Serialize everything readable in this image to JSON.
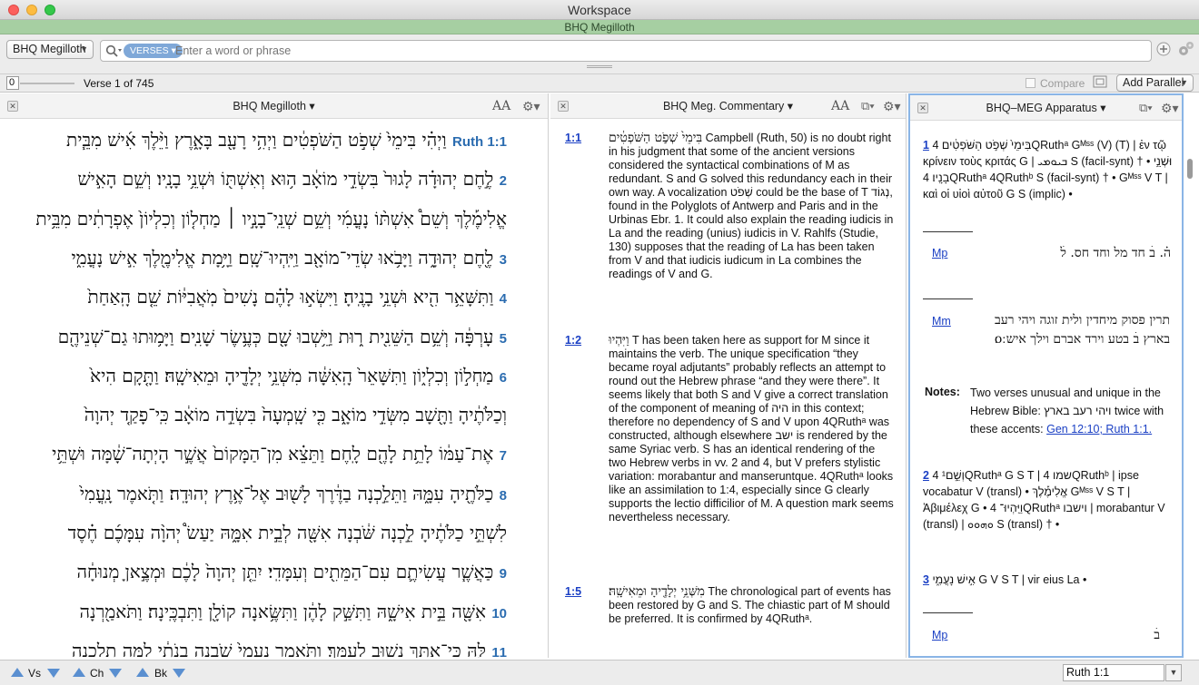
{
  "window": {
    "title": "Workspace",
    "subtitle": "BHQ Megilloth"
  },
  "toolbar": {
    "resource": "BHQ Megilloth",
    "search_scope": "VERSES",
    "search_placeholder": "Enter a word or phrase"
  },
  "navbar": {
    "position_box": "0",
    "verse_info": "Verse 1 of 745",
    "compare": "Compare",
    "add_parallel": "Add Parallel"
  },
  "panes": {
    "text": {
      "title": "BHQ Megilloth",
      "font_btn": "AA"
    },
    "commentary": {
      "title": "BHQ Meg. Commentary",
      "font_btn": "AA"
    },
    "apparatus": {
      "title": "BHQ–MEG Apparatus"
    }
  },
  "text_lines": [
    {
      "vn": "Ruth 1:1",
      "t": "וַיְהִ֗י בִּימֵי֙ שְׁפֹ֣ט הַשֹּׁפְטִ֔ים וַיְהִ֥י רָעָ֖ב בָּאָ֑רֶץ וַיֵּ֨לֶךְ אִ֜ישׁ מִבֵּ֧ית"
    },
    {
      "vn": "2",
      "t": "לֶ֣חֶם יְהוּדָ֗ה לָגוּר֙ בִּשְׂדֵ֣י מוֹאָ֔ב ה֥וּא וְאִשְׁתּ֖וֹ וּשְׁנֵ֥י בָנָֽיו׃ וְשֵׁ֣ם הָאִ֣ישׁ"
    },
    {
      "vn": "",
      "t": "אֱלִימֶ֡לֶךְ וְשֵׁם֩ אִשְׁתּ֨וֹ נָעֳמִ֜י וְשֵׁ֥ם שְׁנֵֽי־בָנָ֣יו ׀ מַחְל֤וֹן וְכִלְיוֹן֙ אֶפְרָתִ֔ים מִבֵּ֥ית"
    },
    {
      "vn": "3",
      "t": "לֶ֖חֶם יְהוּדָ֑ה וַיָּבֹ֥אוּ שְׂדֵי־מוֹאָ֖ב וַיִּֽהְיוּ־שָֽׁם׃ וַיָּ֥מָת אֱלִימֶ֖לֶךְ אִ֣ישׁ נָעֳמִ֑י"
    },
    {
      "vn": "4",
      "t": "וַתִּשָּׁאֵ֥ר הִ֖יא וּשְׁנֵ֥י בָנֶֽיהָ׃ וַיִּשְׂא֣וּ לָהֶ֗ם נָשִׁים֙ מֹֽאֲבִיּ֔וֹת שֵׁ֤ם הָֽאַחַת֙"
    },
    {
      "vn": "5",
      "t": "עָרְפָּ֔ה וְשֵׁ֥ם הַשֵּׁנִ֖ית ר֑וּת וַיֵּ֥שְׁבוּ שָׁ֖ם כְּעֶ֥שֶׂר שָׁנִֽים׃ וַיָּמ֥וּתוּ גַם־שְׁנֵיהֶ֖ם"
    },
    {
      "vn": "6",
      "t": "מַחְל֣וֹן וְכִלְי֑וֹן וַתִּשָּׁאֵר֙ הָֽאִשָּׁ֔ה מִשְּׁנֵ֥י יְלָדֶ֖יהָ וּמֵאִישָֽׁהּ׃ וַתָּ֤קָם הִיא֙"
    },
    {
      "vn": "",
      "t": "וְכַלֹּתֶ֔יהָ וַתָּ֖שָׁב מִשְּׂדֵ֣י מוֹאָ֑ב כִּ֤י שָֽׁמְעָה֙ בִּשְׂדֵ֣ה מוֹאָ֔ב כִּֽי־פָקַ֤ד יְהוָה֙"
    },
    {
      "vn": "7",
      "t": "אֶת־עַמּ֔וֹ לָתֵ֥ת לָהֶ֖ם לָֽחֶם׃ וַתֵּצֵ֗א מִן־הַמָּקוֹם֙ אֲשֶׁ֣ר הָיְתָה־שָׁ֔מָּה וּשְׁתֵּ֥י"
    },
    {
      "vn": "8",
      "t": "כַלֹּתֶ֖יהָ עִמָּ֑הּ וַתֵּלַ֣כְנָה בַדֶּ֔רֶךְ לָשׁ֖וּב אֶל־אֶ֥רֶץ יְהוּדָֽה׃ וַתֹּ֤אמֶר נָֽעֳמִי֙"
    },
    {
      "vn": "",
      "t": "לִשְׁתֵּ֣י כַלֹּתֶ֔יהָ לֵ֣כְנָה שֹּׁ֔בְנָה אִשָּׁ֖ה לְבֵ֣ית אִמָּ֑הּ יַעַשׂ֩ יְהוָ֨ה עִמָּכֶ֜ם חֶ֗סֶד"
    },
    {
      "vn": "9",
      "t": "כַּאֲשֶׁ֧ר עֲשִׂיתֶ֛ם עִם־הַמֵּתִ֖ים וְעִמָּדִֽי׃ יִתֵּ֤ן יְהוָה֙ לָכֶ֔ם וּמְצֶ֣אןָ מְנוּחָ֔ה"
    },
    {
      "vn": "10",
      "t": "אִשָּׁ֖ה בֵּ֣ית אִישָׁ֑הּ וַתִּשַּׁ֣ק לָהֶ֔ן וַתִּשֶּׂ֥אנָה קוֹלָ֖ן וַתִּבְכֶּֽינָה׃ וַתֹּאמַ֖רְנָה"
    },
    {
      "vn": "11",
      "t": "לָּ֑הּ כִּֽי־אִתָּ֥ךְ נָשׁ֖וּב לְעַמֵּֽךְ׃ וַתֹּ֤אמֶר נָעֳמִי֙ שֹׁ֣בְנָה בְנֹתַ֔י לָ֥מָּה תֵלַ֖כְנָה"
    }
  ],
  "commentary": [
    {
      "ref": "1:1",
      "heb": "בִּימֵי֙ שְׁפֹ֣ט הַשֹּׁפְטִ֔ים",
      "text": "Campbell (Ruth, 50) is no doubt right in his judgment that some of the ancient versions considered the syntactical combinations of M as redundant. S and G solved this redundancy each in their own way. A vocalization שְׁפֹט could be the base of T נְגוֹד, found in the Polyglots of Antwerp and Paris and in the Urbinas Ebr. 1. It could also explain the reading iudicis in La and the reading (unius) iudicis in V. Rahlfs (Studie, 130) supposes that the reading of La has been taken from V and that iudicis iudicum in La combines the readings of V and G."
    },
    {
      "ref": "1:2",
      "heb": "וַיִּהְיוּ",
      "text": "T has been taken here as support for M since it maintains the verb. The unique specification “they became royal adjutants” probably reflects an attempt to round out the Hebrew phrase “and they were there”. It seems likely that both S and V give a correct translation of the component of meaning of היה in this context; therefore no dependency of S and V upon 4QRuthᵃ was constructed, although elsewhere ישב is rendered by the same Syriac verb. S has an identical rendering of the two Hebrew verbs in vv. 2 and 4, but V prefers stylistic variation: morabantur and manseruntque. 4QRuthᵃ looks like an assimilation to 1:4, especially since G clearly supports the lectio difficilior of M. A question mark seems nevertheless necessary."
    },
    {
      "ref": "1:5",
      "heb": "מִשְּׁנֵ֥י יְלָדֶ֖יהָ וּמֵאִישָֽׁהּ׃",
      "text": "The chronological part of events has been restored by G and S. The chiastic part of M should be preferred. It is confirmed by 4QRuthᵃ."
    }
  ],
  "apparatus": {
    "e1_num": "1",
    "e1_text": "בִּימֵי֙ שְׁפֹ֣ט הַשֹּׁפְטִ֔ים 4QRuthᵃ Gᴹˢˢ (V) (T) | ἐν τῷ κρίνειν τοὺς κριτάς G | ܒܝܘܡܝ S (facil-synt) † • וּשְׁנֵ֥י בָנָֽיו׃ 4QRuthᵃ 4QRuthᵇ S (facil-synt) † • Gᴹˢˢ V T | καὶ οἱ υἱοὶ αὐτοῦ G S (implic) •",
    "mp1_label": "Mp",
    "mp1_text": "ה֗. בׄ חד מל וחד חס. לׄ",
    "mm_label": "Mm",
    "mm_text": "תרין פסוק מיחדין ולית זוגה ויהי רעב בארץ בׄ בטע וירד אברם וילך איש ׃o׃",
    "notes_label": "Notes:",
    "notes_text": "Two verses unusual and unique in the Hebrew Bible: ויהי רעב בארץ twice with these accents:",
    "notes_links": "Gen 12:10; Ruth 1:1.",
    "e2_num": "2",
    "e2_text": "וְשֵׁ֣ם¹ 4QRuthᵃ G S T | שמו 4QRuthᵇ | ipse vocabatur V (transl) • אֱלִימֶ֡לֶךְ Gᴹˢˢ V S T | Ἀβιμέλεχ G • וַיִּֽהְיוּ־ 4QRuthᵃ וישבו | morabantur V (transl) | ܘܗܘܘ S (transl) † •",
    "e3_num": "3",
    "e3_text": "אִ֣ישׁ נָעֳמִ֑י G V S T | vir eius La •",
    "mp2_label": "Mp",
    "mp2_text": "בׄ"
  },
  "status": {
    "vs": "Vs",
    "ch": "Ch",
    "bk": "Bk",
    "reference": "Ruth 1:1"
  },
  "colors": {
    "accent_green": "#a6cfa2",
    "link_blue": "#1a3fc4",
    "verse_blue": "#2b6cb0",
    "pill_blue": "#7fa8d8"
  }
}
